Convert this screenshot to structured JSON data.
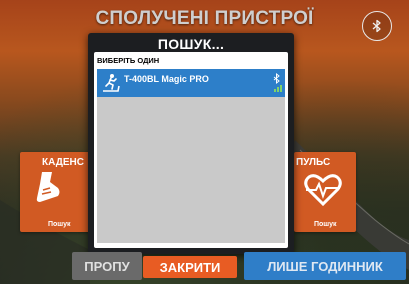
{
  "screen": {
    "title": "СПОЛУЧЕНІ ПРИСТРОЇ",
    "bluetooth_icon": "bluetooth-icon"
  },
  "tiles": {
    "cadence": {
      "title": "КАДЕНС",
      "status": "Пошук",
      "icon": "cadence-shoe-icon"
    },
    "heart_rate": {
      "title": "ПУЛЬС",
      "status": "Пошук",
      "icon": "heart-rate-icon"
    }
  },
  "dialog": {
    "title": "ПОШУК...",
    "heading": "ВИБЕРІТЬ ОДИН",
    "devices": [
      {
        "name": "T-400BL Magic PRO",
        "icon": "treadmill-runner-icon",
        "signal_icon": "bluetooth-signal-icon"
      }
    ]
  },
  "buttons": {
    "skip": "ПРОПУ",
    "close": "ЗАКРИТИ",
    "watch_only": "ЛИШЕ ГОДИННИК"
  },
  "colors": {
    "accent_orange": "#e85c23",
    "tile_orange": "#d15a23",
    "selected_blue": "#2d7fc9",
    "watch_blue": "#2f7ec8",
    "dialog_dark": "#1c1e21"
  }
}
